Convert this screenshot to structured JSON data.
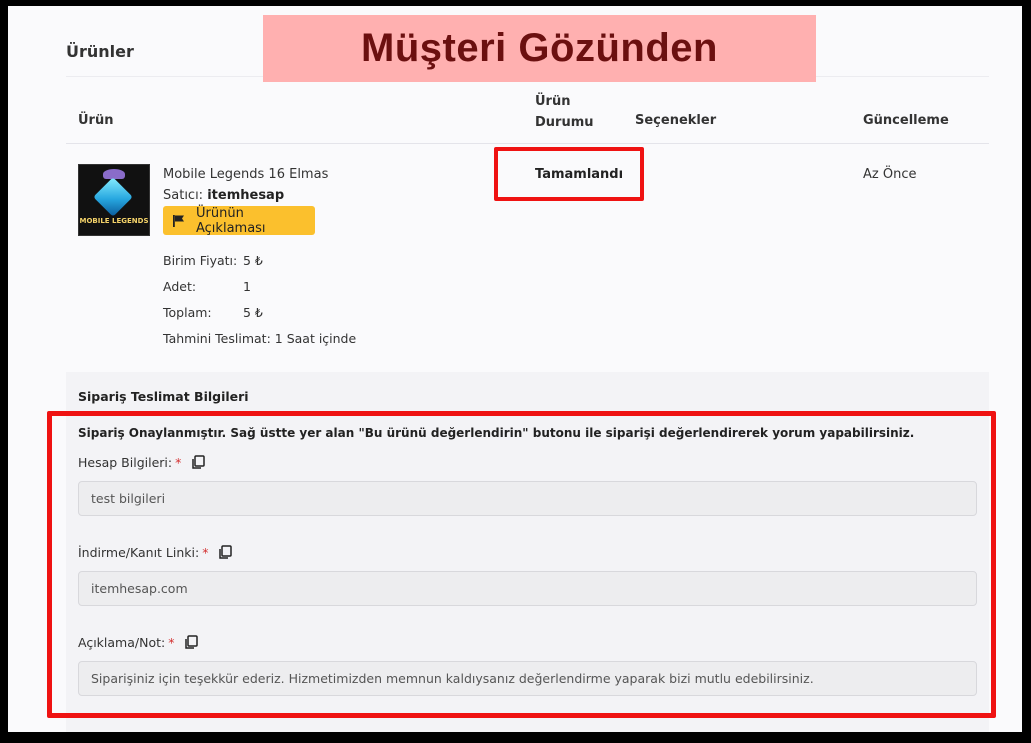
{
  "banner": {
    "text": "Müşteri Gözünden"
  },
  "section": {
    "title": "Ürünler"
  },
  "table": {
    "headers": {
      "product": "Ürün",
      "status": "Ürün Durumu",
      "options": "Seçenekler",
      "updated": "Güncelleme"
    }
  },
  "product": {
    "thumb_text": "MOBILE LEGENDS",
    "name": "Mobile Legends 16 Elmas",
    "seller_label": "Satıcı:",
    "seller_name": "itemhesap",
    "desc_button": "Ürünün Açıklaması",
    "unit_price_label": "Birim Fiyatı:",
    "unit_price": "5 ₺",
    "qty_label": "Adet:",
    "qty": "1",
    "total_label": "Toplam:",
    "total": "5 ₺",
    "eta_label": "Tahmini Teslimat:",
    "eta": "1 Saat içinde",
    "status": "Tamamlandı",
    "updated": "Az Önce"
  },
  "delivery": {
    "title": "Sipariş Teslimat Bilgileri",
    "note": "Sipariş Onaylanmıştır. Sağ üstte yer alan \"Bu ürünü değerlendirin\" butonu ile siparişi değerlendirerek yorum yapabilirsiniz.",
    "fields": [
      {
        "label": "Hesap Bilgileri:",
        "required": "*",
        "value": "test bilgileri"
      },
      {
        "label": "İndirme/Kanıt Linki:",
        "required": "*",
        "value": "itemhesap.com"
      },
      {
        "label": "Açıklama/Not:",
        "required": "*",
        "value": "Siparişiniz için teşekkür ederiz. Hizmetimizden memnun kaldıysanız değerlendirme yaparak bizi mutlu edebilirsiniz."
      }
    ]
  },
  "colors": {
    "highlight": "#ef1212",
    "button": "#fbc02d",
    "banner_bg": "#ffb0b0",
    "banner_text": "#6b1010"
  }
}
